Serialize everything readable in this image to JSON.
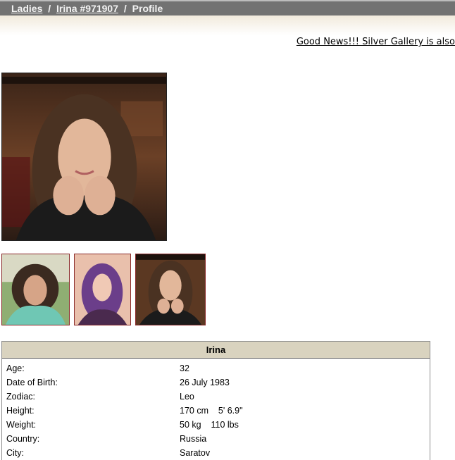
{
  "breadcrumb": {
    "items": [
      "Ladies",
      "Irina #971907",
      "Profile"
    ],
    "separator": "/"
  },
  "news": {
    "text": "Good News!!! Silver Gallery is also"
  },
  "photos": {
    "main": "profile-photo",
    "thumbnails": [
      "thumbnail-photo-1",
      "thumbnail-photo-2",
      "thumbnail-photo-3"
    ]
  },
  "profile": {
    "name": "Irina",
    "fields": [
      {
        "label": "Age:",
        "value": "32"
      },
      {
        "label": "Date of Birth:",
        "value": "26 July 1983"
      },
      {
        "label": "Zodiac:",
        "value": "Leo"
      },
      {
        "label": "Height:",
        "value": "170 cm    5' 6.9\""
      },
      {
        "label": "Weight:",
        "value": "50 kg    110 lbs"
      },
      {
        "label": "Country:",
        "value": "Russia"
      },
      {
        "label": "City:",
        "value": "Saratov"
      }
    ]
  },
  "colors": {
    "breadcrumb_bg": "#727272",
    "profile_header_bg": "#d9d3bf",
    "thumb_border": "#8a2a2a"
  }
}
